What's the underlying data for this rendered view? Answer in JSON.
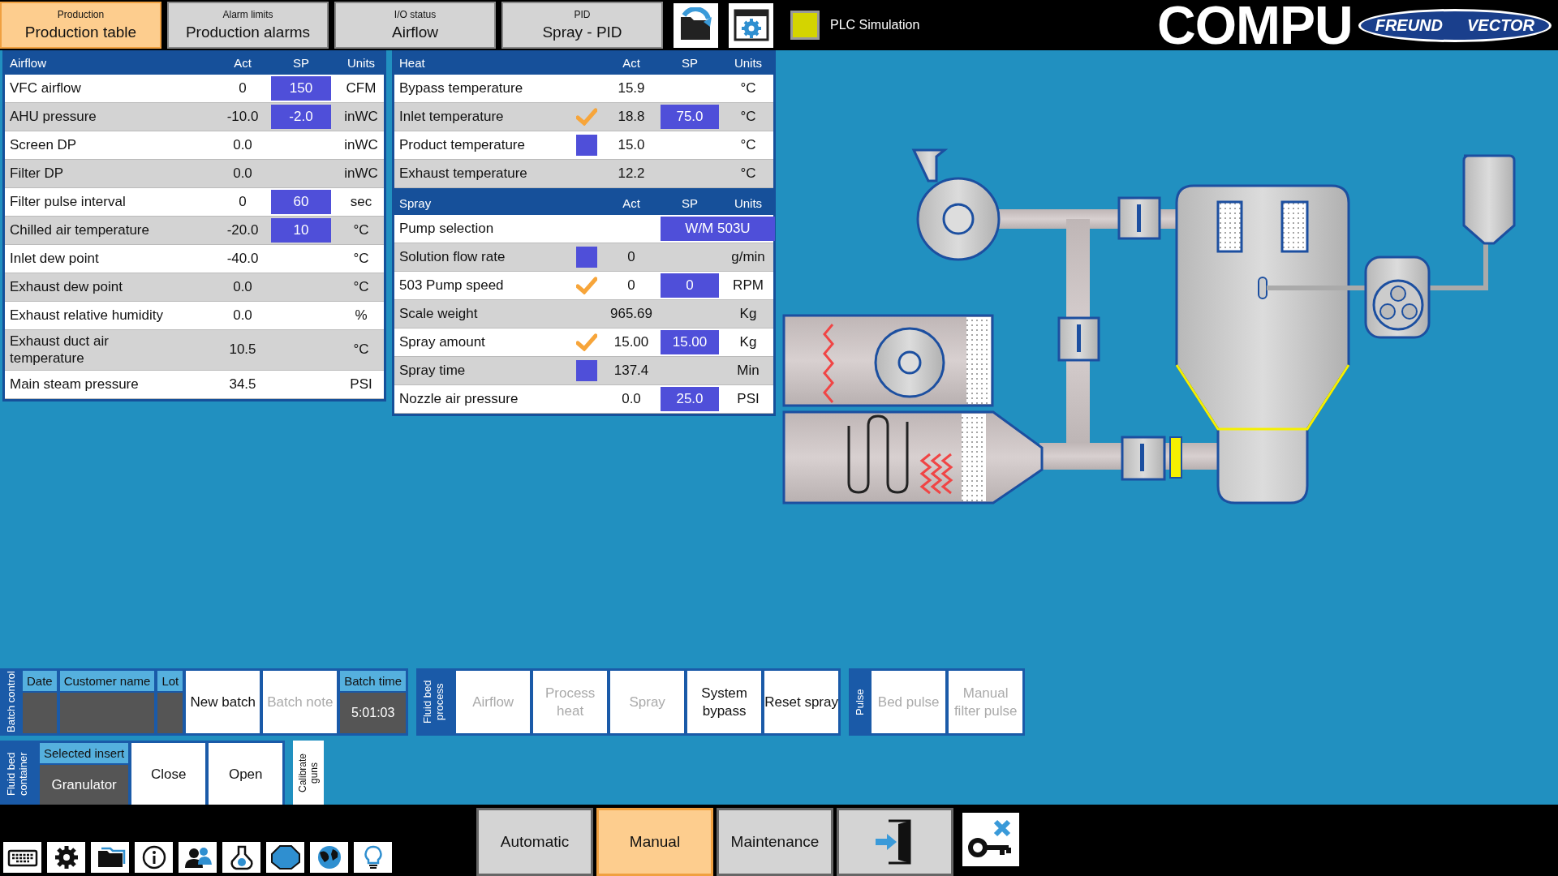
{
  "top_tabs": [
    {
      "caption": "Production",
      "label": "Production table",
      "selected": true
    },
    {
      "caption": "Alarm limits",
      "label": "Production alarms",
      "selected": false
    },
    {
      "caption": "I/O status",
      "label": "Airflow",
      "selected": false
    },
    {
      "caption": "PID",
      "label": "Spray - PID",
      "selected": false
    }
  ],
  "plc_simulation": {
    "label": "PLC Simulation",
    "on": true
  },
  "logo": {
    "text": "COMPU",
    "badge_left": "FREUND",
    "badge_right": "VECTOR"
  },
  "airflow_table": {
    "columns": [
      "Airflow",
      "Act",
      "SP",
      "Units"
    ],
    "rows": [
      {
        "name": "VFC airflow",
        "act": "0",
        "sp": "150",
        "unit": "CFM"
      },
      {
        "name": "AHU pressure",
        "act": "-10.0",
        "sp": "-2.0",
        "unit": "inWC"
      },
      {
        "name": "Screen DP",
        "act": "0.0",
        "unit": "inWC"
      },
      {
        "name": "Filter DP",
        "act": "0.0",
        "unit": "inWC"
      },
      {
        "name": "Filter pulse interval",
        "act": "0",
        "sp": "60",
        "unit": "sec"
      },
      {
        "name": "Chilled air temperature",
        "act": "-20.0",
        "sp": "10",
        "unit": "°C"
      },
      {
        "name": "Inlet dew point",
        "act": "-40.0",
        "unit": "°C"
      },
      {
        "name": "Exhaust dew point",
        "act": "0.0",
        "unit": "°C"
      },
      {
        "name": "Exhaust relative humidity",
        "act": "0.0",
        "unit": "%"
      },
      {
        "name": "Exhaust duct air temperature",
        "act": "10.5",
        "unit": "°C"
      },
      {
        "name": "Main steam pressure",
        "act": "34.5",
        "unit": "PSI"
      }
    ]
  },
  "heat_table": {
    "columns": [
      "Heat",
      "Act",
      "SP",
      "Units"
    ],
    "rows": [
      {
        "name": "Bypass temperature",
        "kind": "plain",
        "act": "15.9",
        "unit": "°C"
      },
      {
        "name": "Inlet temperature",
        "kind": "check",
        "act": "18.8",
        "sp": "75.0",
        "unit": "°C"
      },
      {
        "name": "Product temperature",
        "kind": "box",
        "act": "15.0",
        "unit": "°C"
      },
      {
        "name": "Exhaust temperature",
        "kind": "plain",
        "act": "12.2",
        "unit": "°C"
      }
    ]
  },
  "spray_table": {
    "columns": [
      "Spray",
      "Act",
      "SP",
      "Units"
    ],
    "rows": [
      {
        "name": "Pump selection",
        "kind": "plain",
        "sp": "W/M 503U"
      },
      {
        "name": "Solution flow rate",
        "kind": "box",
        "act": "0",
        "unit": "g/min"
      },
      {
        "name": "503 Pump speed",
        "kind": "check",
        "act": "0",
        "sp": "0",
        "unit": "RPM"
      },
      {
        "name": "Scale weight",
        "kind": "plain",
        "act": "965.69",
        "unit": "Kg"
      },
      {
        "name": "Spray amount",
        "kind": "check",
        "act": "15.00",
        "sp": "15.00",
        "unit": "Kg"
      },
      {
        "name": "Spray time",
        "kind": "box",
        "act": "137.4",
        "unit": "Min"
      },
      {
        "name": "Nozzle air pressure",
        "kind": "plain",
        "act": "0.0",
        "sp": "25.0",
        "unit": "PSI"
      }
    ]
  },
  "batch_control": {
    "label": "Batch control",
    "fields": [
      {
        "label": "Date"
      },
      {
        "label": "Customer name"
      },
      {
        "label": "Lot"
      }
    ],
    "buttons": [
      {
        "label": "New batch",
        "disabled": false
      },
      {
        "label": "Batch note",
        "disabled": true
      }
    ],
    "batch_time": {
      "label": "Batch time",
      "value": "5:01:03"
    }
  },
  "fluid_bed_process": {
    "label": "Fluid bed process",
    "buttons": [
      {
        "label": "Airflow",
        "disabled": true
      },
      {
        "label": "Process heat",
        "disabled": true
      },
      {
        "label": "Spray",
        "disabled": true
      },
      {
        "label": "System bypass",
        "disabled": false
      },
      {
        "label": "Reset spray",
        "disabled": false
      }
    ]
  },
  "pulse": {
    "label": "Pulse",
    "buttons": [
      {
        "label": "Bed pulse",
        "disabled": true
      },
      {
        "label": "Manual filter pulse",
        "disabled": true
      }
    ]
  },
  "fluid_bed_container": {
    "label": "Fluid bed container",
    "selected_insert": {
      "label": "Selected insert",
      "value": "Granulator"
    },
    "buttons": [
      {
        "label": "Close",
        "disabled": false
      },
      {
        "label": "Open",
        "disabled": false
      }
    ]
  },
  "calibrate_guns": {
    "label": "Calibrate guns"
  },
  "mode_buttons": [
    {
      "label": "Automatic",
      "selected": false
    },
    {
      "label": "Manual",
      "selected": true
    },
    {
      "label": "Maintenance",
      "selected": false
    }
  ]
}
